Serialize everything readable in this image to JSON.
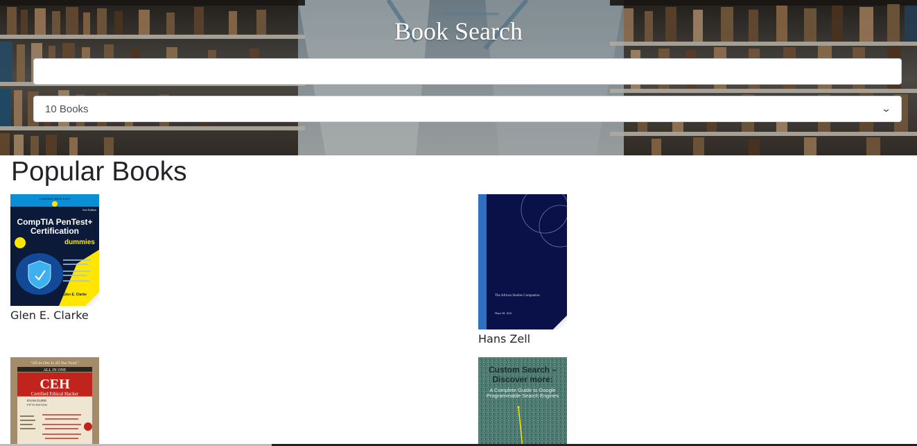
{
  "hero": {
    "title": "Book Search",
    "search_value": "",
    "count_selected": "10 Books"
  },
  "section": {
    "title": "Popular Books"
  },
  "books": [
    {
      "author": "Glen E. Clarke",
      "cover": {
        "brand": "LEARNING MADE EASY",
        "edition": "2nd Edition",
        "title_line1": "CompTIA PenTest+",
        "title_line2": "Certification",
        "series": "dummies",
        "author": "Glen E. Clarke"
      }
    },
    {
      "author": "Hans Zell",
      "cover": {
        "title": "The African Studies Companion",
        "author": "Hans M. Zell"
      }
    },
    {
      "author": "",
      "cover": {
        "tagline": "\"All-in-One Is All You Need.\"",
        "series": "ALL IN ONE",
        "title": "CEH",
        "subtitle": "Certified Ethical Hacker",
        "guide": "EXAM GUIDE",
        "edition": "FIFTH EDITION"
      }
    },
    {
      "author": "",
      "cover": {
        "title_line1": "Custom Search –",
        "title_line2": "Discover more:",
        "subtitle_line1": "A Complete Guide to Google",
        "subtitle_line2": "Programmable Search Engines"
      }
    }
  ],
  "colors": {
    "dummies_yellow": "#ffe600",
    "dummies_blue": "#0a8fd6",
    "african_navy": "#0a1048",
    "african_blue": "#2f6fc0",
    "ceh_tan": "#a48c6a",
    "ceh_red": "#c0241c",
    "custom_teal": "#4d7a70"
  }
}
